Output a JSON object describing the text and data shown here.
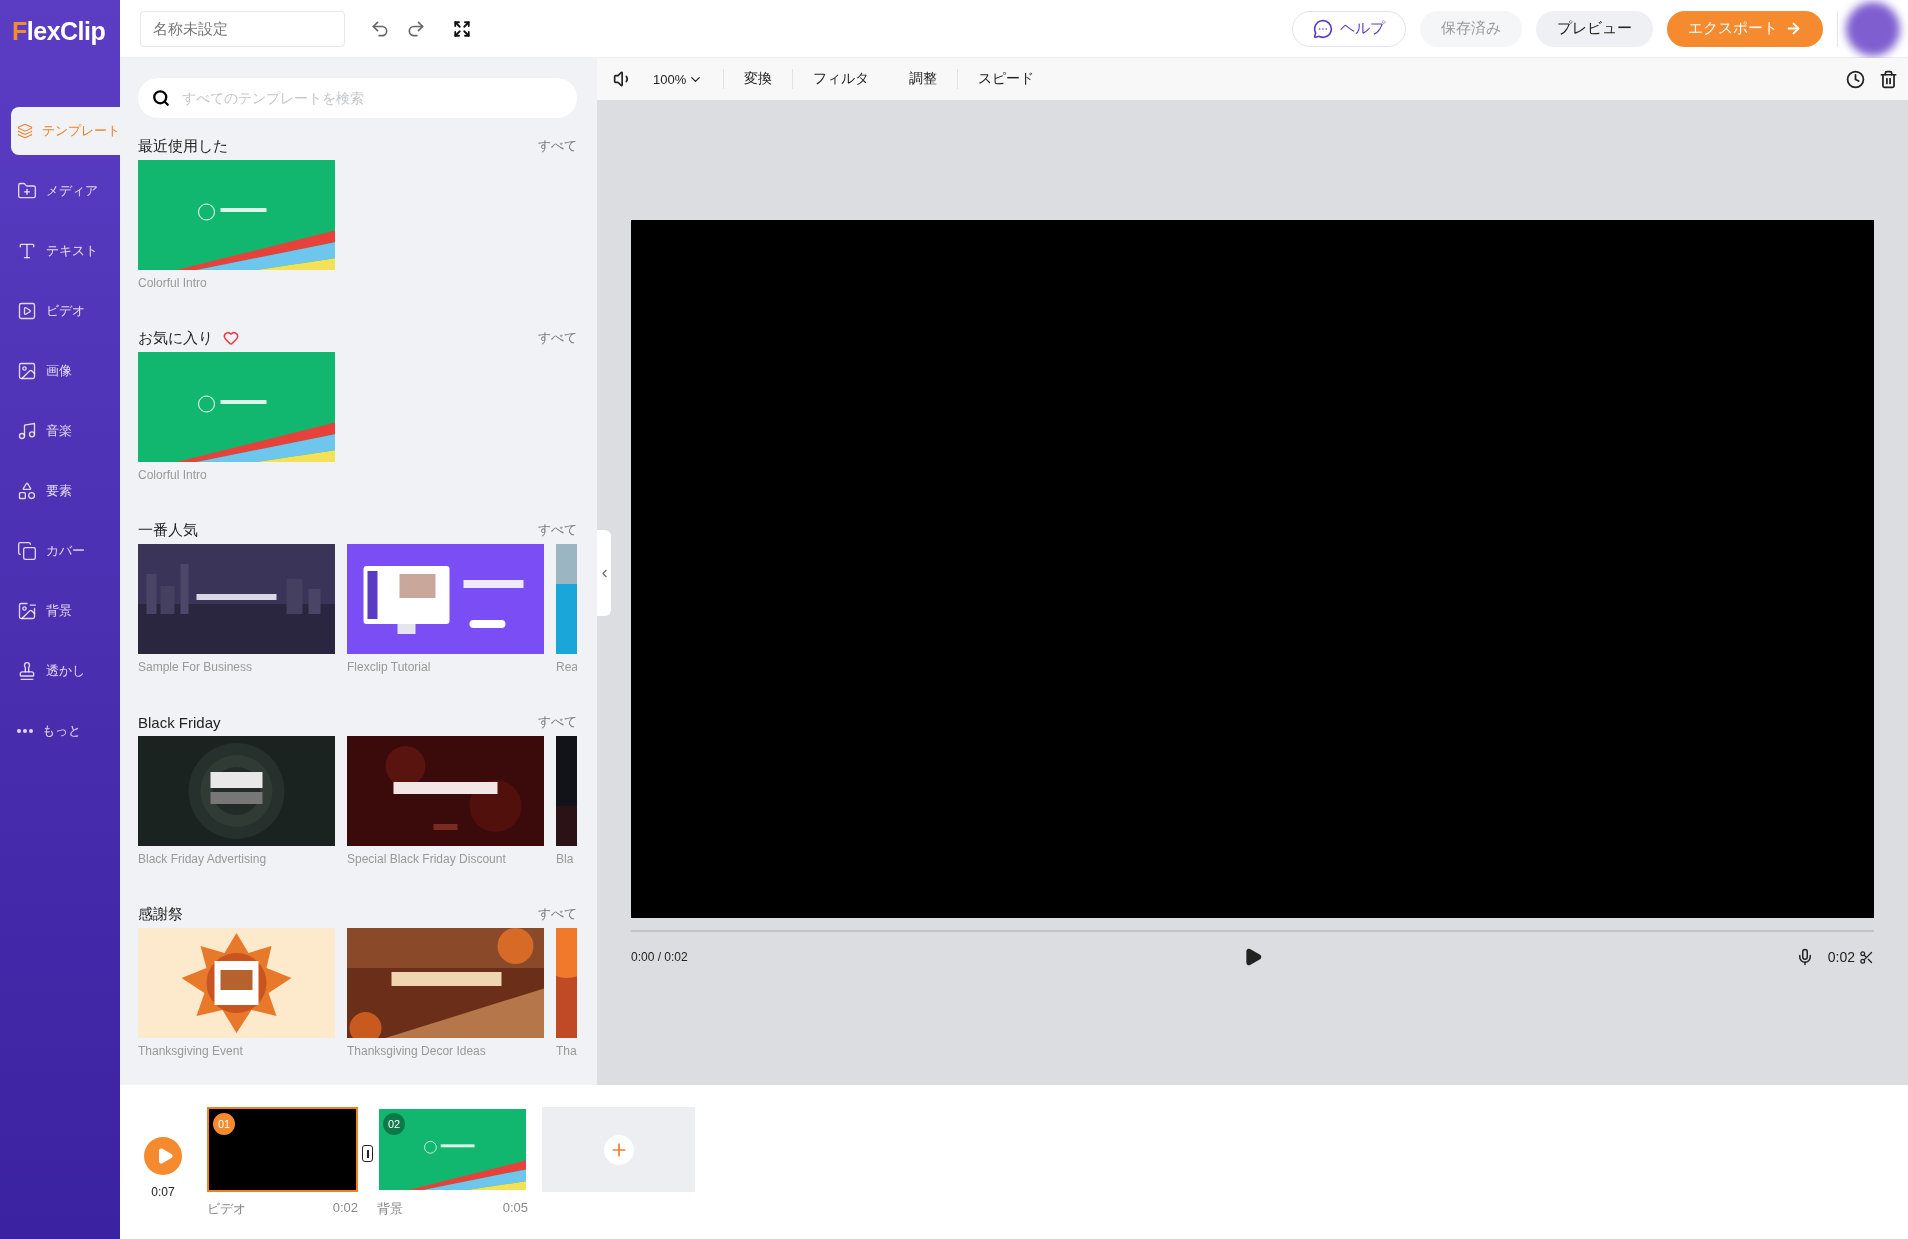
{
  "app": {
    "logo": "FlexClip"
  },
  "topbar": {
    "title_placeholder": "名称未設定",
    "help": "ヘルプ",
    "saved": "保存済み",
    "preview": "プレビュー",
    "export": "エクスポート"
  },
  "sidebar": {
    "items": [
      {
        "label": "テンプレート",
        "selected": true
      },
      {
        "label": "メディア",
        "selected": false
      },
      {
        "label": "テキスト",
        "selected": false
      },
      {
        "label": "ビデオ",
        "selected": false
      },
      {
        "label": "画像",
        "selected": false
      },
      {
        "label": "音楽",
        "selected": false
      },
      {
        "label": "要素",
        "selected": false
      },
      {
        "label": "カバー",
        "selected": false
      },
      {
        "label": "背景",
        "selected": false
      },
      {
        "label": "透かし",
        "selected": false
      },
      {
        "label": "もっと",
        "selected": false
      }
    ]
  },
  "panel": {
    "search": {
      "placeholder": "すべてのテンプレートを検索"
    },
    "sections": [
      {
        "title": "最近使用した",
        "heart": false,
        "more": "すべて",
        "templates": [
          {
            "caption": "Colorful Intro"
          }
        ]
      },
      {
        "title": "お気に入り",
        "heart": true,
        "more": "すべて",
        "templates": [
          {
            "caption": "Colorful Intro"
          }
        ]
      },
      {
        "title": "一番人気",
        "heart": false,
        "more": "すべて",
        "templates": [
          {
            "caption": "Sample For Business"
          },
          {
            "caption": "Flexclip Tutorial"
          },
          {
            "caption": "Rea"
          }
        ]
      },
      {
        "title": "Black Friday",
        "heart": false,
        "more": "すべて",
        "templates": [
          {
            "caption": "Black Friday Advertising"
          },
          {
            "caption": "Special Black Friday Discount"
          },
          {
            "caption": "Bla"
          }
        ]
      },
      {
        "title": "感謝祭",
        "heart": false,
        "more": "すべて",
        "templates": [
          {
            "caption": "Thanksgiving Event"
          },
          {
            "caption": "Thanksgiving Decor Ideas"
          },
          {
            "caption": "Tha"
          }
        ]
      }
    ]
  },
  "toolbar": {
    "zoom": "100%",
    "tools": [
      "変換",
      "フィルタ",
      "調整",
      "スピード"
    ]
  },
  "player": {
    "time": "0:00 / 0:02",
    "duration": "0:02"
  },
  "timeline": {
    "total": "0:07",
    "clips": [
      {
        "number": "01",
        "label": "ビデオ",
        "duration": "0:02",
        "selected": true
      },
      {
        "number": "02",
        "label": "背景",
        "duration": "0:05",
        "selected": false
      }
    ]
  }
}
